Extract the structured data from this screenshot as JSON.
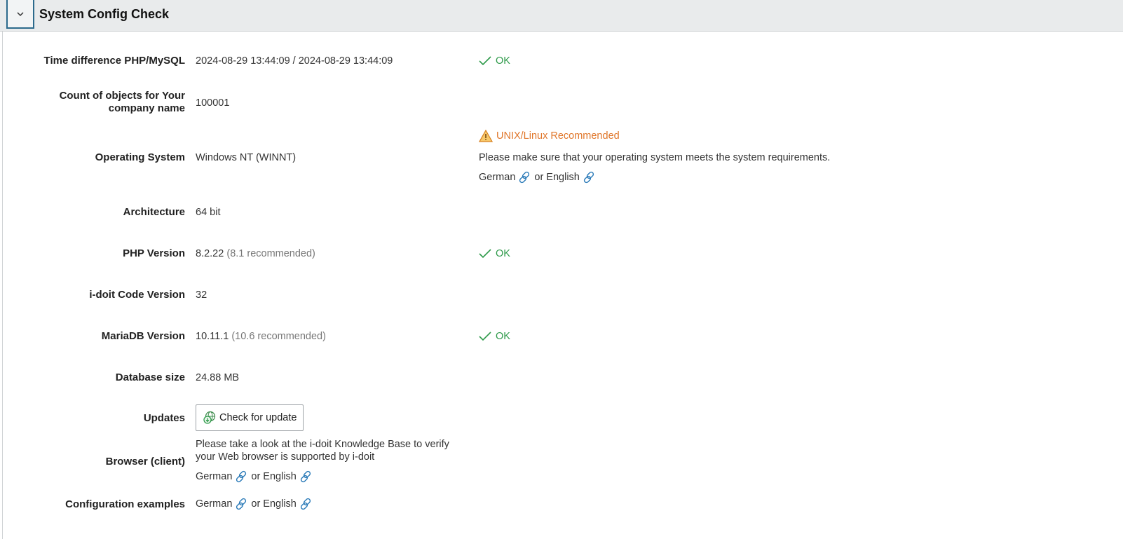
{
  "header": {
    "title": "System Config Check"
  },
  "rows": {
    "time": {
      "label": "Time difference PHP/MySQL",
      "value": "2024-08-29 13:44:09 / 2024-08-29 13:44:09",
      "status": "OK"
    },
    "count": {
      "label_line1": "Count of objects for Your",
      "label_line2": "company name",
      "value": "100001"
    },
    "os": {
      "label": "Operating System",
      "value": "Windows NT (WINNT)",
      "warning": "UNIX/Linux Recommended",
      "note": "Please make sure that your operating system meets the system requirements.",
      "link_german": "German",
      "or": "or",
      "link_english": "English"
    },
    "arch": {
      "label": "Architecture",
      "value": "64 bit"
    },
    "php": {
      "label": "PHP Version",
      "value": "8.2.22",
      "recommended": "(8.1 recommended)",
      "status": "OK"
    },
    "code": {
      "label": "i-doit Code Version",
      "value": "32"
    },
    "mariadb": {
      "label": "MariaDB Version",
      "value": "10.11.1",
      "recommended": "(10.6 recommended)",
      "status": "OK"
    },
    "dbsize": {
      "label": "Database size",
      "value": "24.88 MB"
    },
    "updates": {
      "label": "Updates",
      "button": "Check for update"
    },
    "browser": {
      "label": "Browser (client)",
      "text_line1": "Please take a look at the i-doit Knowledge Base to verify",
      "text_line2": "your Web browser is supported by i-doit",
      "link_german": "German",
      "or": "or",
      "link_english": "English"
    },
    "config": {
      "label": "Configuration examples",
      "link_german": "German",
      "or": "or",
      "link_english": "English"
    }
  },
  "colors": {
    "ok": "#2e9a4a",
    "warning": "#e0762a",
    "link_icon": "#2a7ab8",
    "toggle_border": "#2c6a8c"
  },
  "icons": {
    "toggle": "chevron-down-icon",
    "ok": "checkmark-icon",
    "warning": "warning-triangle-icon",
    "link": "link-icon",
    "update": "globe-download-icon"
  }
}
